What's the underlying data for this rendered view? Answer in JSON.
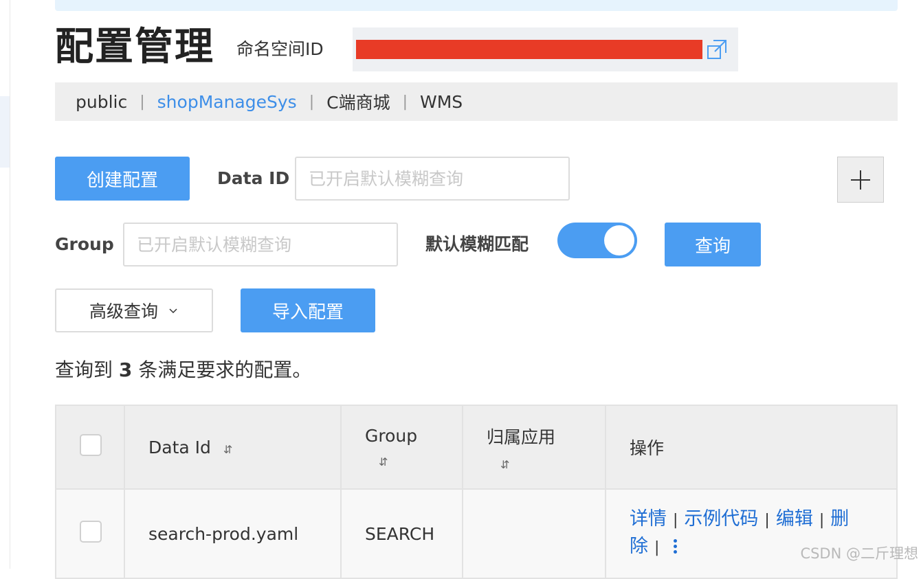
{
  "header": {
    "title": "配置管理",
    "namespace_label": "命名空间ID"
  },
  "namespaces": [
    {
      "label": "public",
      "active": false
    },
    {
      "label": "shopManageSys",
      "active": true
    },
    {
      "label": "C端商城",
      "active": false
    },
    {
      "label": "WMS",
      "active": false
    }
  ],
  "toolbar": {
    "create_label": "创建配置",
    "data_id_label": "Data ID",
    "data_id_placeholder": "已开启默认模糊查询",
    "group_label": "Group",
    "group_placeholder": "已开启默认模糊查询",
    "fuzzy_label": "默认模糊匹配",
    "fuzzy_enabled": true,
    "query_label": "查询",
    "advanced_label": "高级查询",
    "import_label": "导入配置"
  },
  "result": {
    "prefix": "查询到",
    "count": "3",
    "suffix": "条满足要求的配置。"
  },
  "table": {
    "columns": [
      "Data Id",
      "Group",
      "归属应用",
      "操作"
    ],
    "rows": [
      {
        "data_id": "search-prod.yaml",
        "group": "SEARCH",
        "app": "",
        "actions": [
          "详情",
          "示例代码",
          "编辑",
          "删除"
        ]
      }
    ]
  },
  "watermark": "CSDN @二斤理想",
  "colors": {
    "primary": "#4b9df2",
    "link": "#1f6ed4",
    "active_tab": "#3d8ee8",
    "redaction": "#e83b26"
  },
  "icons": [
    "copy-icon",
    "plus-icon",
    "chevron-down-icon",
    "sort-icon",
    "more-vertical-icon"
  ]
}
